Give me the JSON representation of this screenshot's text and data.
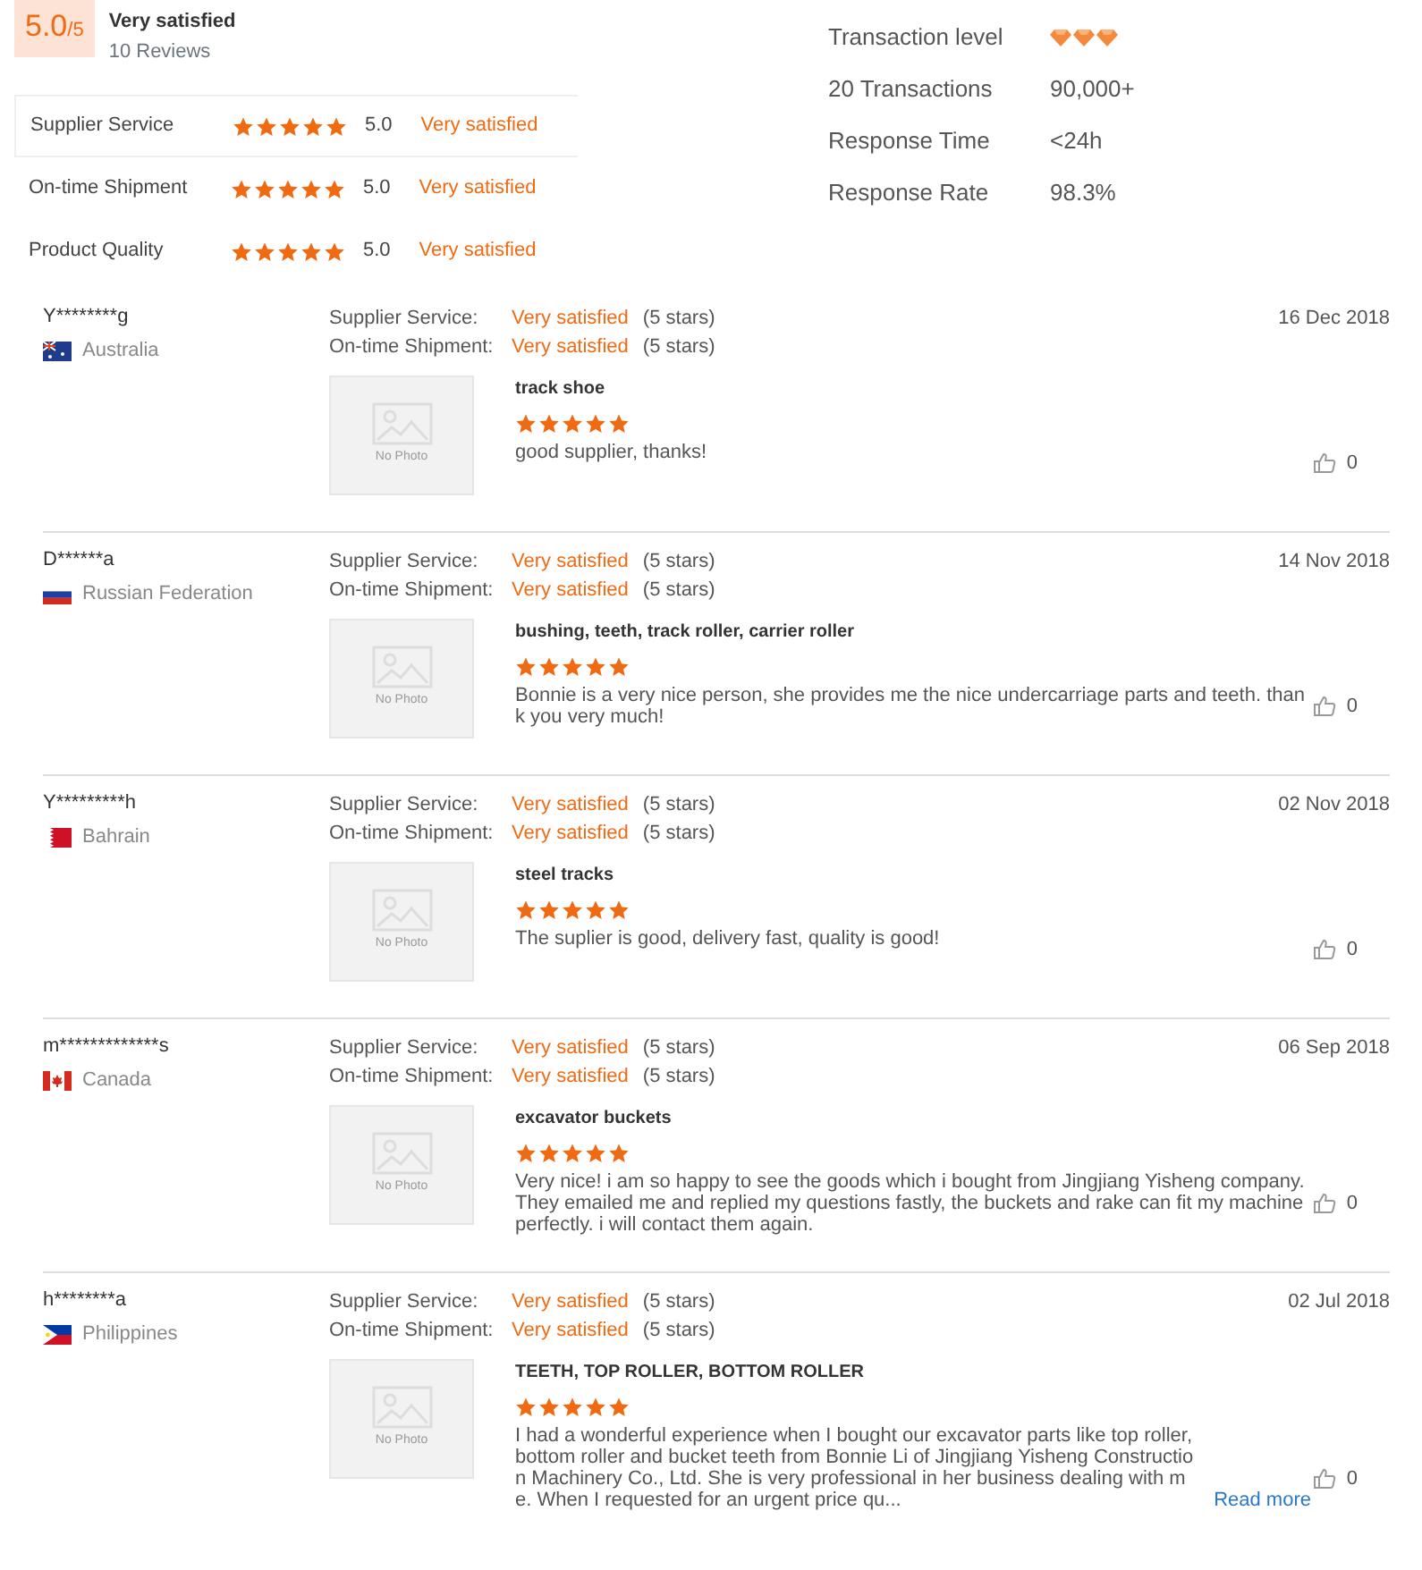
{
  "summary": {
    "score": "5.0",
    "out_of": "/5",
    "verdict": "Very satisfied",
    "reviews": "10 Reviews"
  },
  "ratings": [
    {
      "label": "Supplier Service",
      "stars": 5,
      "value": "5.0",
      "verdict": "Very satisfied",
      "selected": true
    },
    {
      "label": "On-time Shipment",
      "stars": 5,
      "value": "5.0",
      "verdict": "Very satisfied",
      "selected": false
    },
    {
      "label": "Product Quality",
      "stars": 5,
      "value": "5.0",
      "verdict": "Very satisfied",
      "selected": false
    }
  ],
  "stats": [
    {
      "label": "Transaction level",
      "kind": "diamonds",
      "stars": 3
    },
    {
      "label": "20 Transactions",
      "kind": "text",
      "value": "90,000+"
    },
    {
      "label": "Response Time",
      "kind": "text",
      "value": "<24h"
    },
    {
      "label": "Response Rate",
      "kind": "text",
      "value": "98.3%"
    }
  ],
  "reviews": [
    {
      "name": "Y********g",
      "kind": "australia",
      "country": "Australia",
      "date": "16 Dec 2018",
      "scores": [
        {
          "label": "Supplier Service:",
          "verdict": "Very satisfied",
          "stars_text": "(5 stars)"
        },
        {
          "label": "On-time Shipment:",
          "verdict": "Very satisfied",
          "stars_text": "(5 stars)"
        }
      ],
      "photo": "No Photo",
      "product": "track shoe",
      "stars": 5,
      "text": "good supplier, thanks!",
      "likes": "0"
    },
    {
      "name": "D******a",
      "kind": "russia",
      "country": "Russian Federation",
      "date": "14 Nov 2018",
      "scores": [
        {
          "label": "Supplier Service:",
          "verdict": "Very satisfied",
          "stars_text": "(5 stars)"
        },
        {
          "label": "On-time Shipment:",
          "verdict": "Very satisfied",
          "stars_text": "(5 stars)"
        }
      ],
      "photo": "No Photo",
      "product": "bushing, teeth, track roller, carrier roller",
      "stars": 5,
      "text": "Bonnie is a very nice person, she provides me the nice undercarriage parts and teeth. thank you very much!",
      "likes": "0"
    },
    {
      "name": "Y*********h",
      "kind": "bahrain",
      "country": "Bahrain",
      "date": "02 Nov 2018",
      "scores": [
        {
          "label": "Supplier Service:",
          "verdict": "Very satisfied",
          "stars_text": "(5 stars)"
        },
        {
          "label": "On-time Shipment:",
          "verdict": "Very satisfied",
          "stars_text": "(5 stars)"
        }
      ],
      "photo": "No Photo",
      "product": "steel tracks",
      "stars": 5,
      "text": "The suplier is good, delivery fast, quality is good!",
      "likes": "0"
    },
    {
      "name": "m*************s",
      "kind": "canada",
      "country": "Canada",
      "date": "06 Sep 2018",
      "scores": [
        {
          "label": "Supplier Service:",
          "verdict": "Very satisfied",
          "stars_text": "(5 stars)"
        },
        {
          "label": "On-time Shipment:",
          "verdict": "Very satisfied",
          "stars_text": "(5 stars)"
        }
      ],
      "photo": "No Photo",
      "product": "excavator buckets",
      "stars": 5,
      "text": "Very nice! i am so happy to see the goods which i bought from Jingjiang Yisheng company. They emailed me and replied my questions fastly, the buckets and rake can fit my machine perfectly. i will contact them again.",
      "likes": "0"
    },
    {
      "name": "h********a",
      "kind": "philippines",
      "country": "Philippines",
      "date": "02 Jul 2018",
      "scores": [
        {
          "label": "Supplier Service:",
          "verdict": "Very satisfied",
          "stars_text": "(5 stars)"
        },
        {
          "label": "On-time Shipment:",
          "verdict": "Very satisfied",
          "stars_text": "(5 stars)"
        }
      ],
      "photo": "No Photo",
      "product": "TEETH, TOP ROLLER, BOTTOM ROLLER",
      "stars": 5,
      "text": "I had a wonderful experience when I bought our excavator parts like top roller, bottom roller and bucket teeth from Bonnie Li of Jingjiang Yisheng Construction Machinery Co., Ltd.   She is very professional in her business dealing with me.  When I requested for an urgent price qu...",
      "more": "Read more",
      "likes": "0"
    }
  ]
}
